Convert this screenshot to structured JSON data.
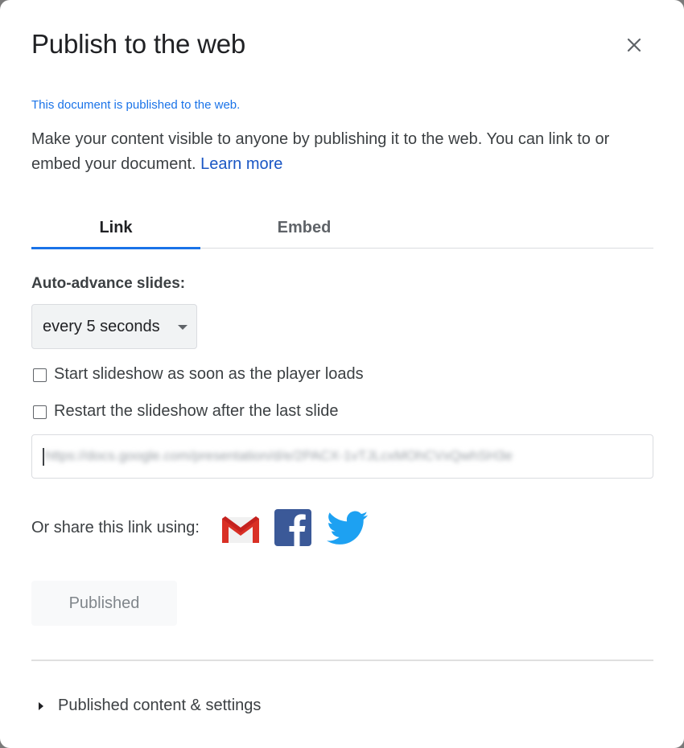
{
  "dialog": {
    "title": "Publish to the web",
    "status": "This document is published to the web.",
    "description": "Make your content visible to anyone by publishing it to the web. You can link to or embed your document.",
    "learn_more": "Learn more"
  },
  "tabs": [
    {
      "label": "Link",
      "selected": true
    },
    {
      "label": "Embed",
      "selected": false
    }
  ],
  "link_tab": {
    "auto_advance_label": "Auto-advance slides:",
    "auto_advance_value": "every 5 seconds",
    "start_on_load_label": "Start slideshow as soon as the player loads",
    "start_on_load_checked": false,
    "restart_label": "Restart the slideshow after the last slide",
    "restart_checked": false,
    "url": "https://docs.google.com/presentation/d/e/2PACX-1vTJLcxMOhCVxQwhSH3e",
    "share_label": "Or share this link using:",
    "share_icons": [
      "gmail-icon",
      "facebook-icon",
      "twitter-icon"
    ],
    "published_button": "Published"
  },
  "footer": {
    "settings_toggle": "Published content & settings"
  },
  "colors": {
    "accent": "#1a73e8",
    "gmail_red": "#d93025",
    "facebook_blue": "#3b5998",
    "twitter_blue": "#1da1f2"
  }
}
